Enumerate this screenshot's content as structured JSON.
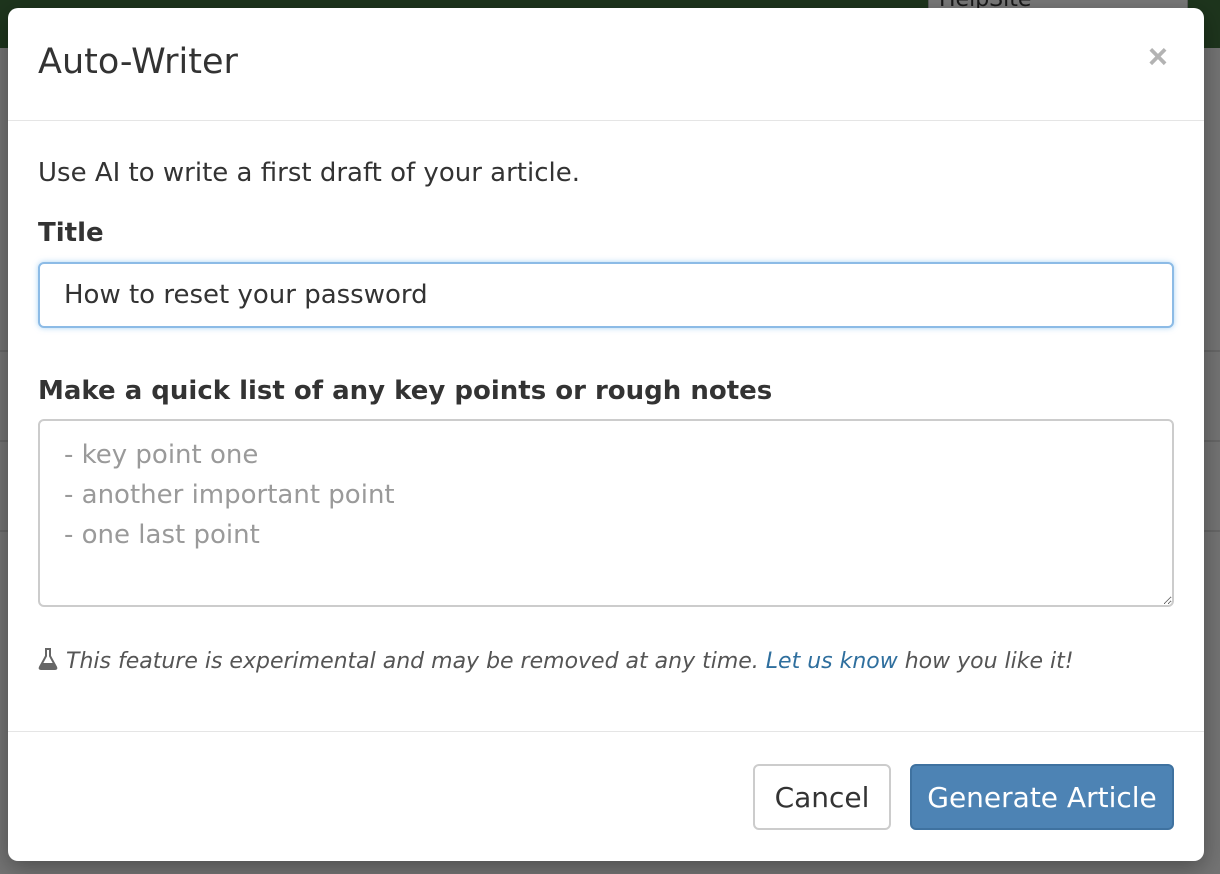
{
  "background": {
    "site_select_value": "HelpSite"
  },
  "modal": {
    "title": "Auto-Writer",
    "close_symbol": "×",
    "intro": "Use AI to write a first draft of your article.",
    "title_field": {
      "label": "Title",
      "value": "How to reset your password"
    },
    "notes_field": {
      "label": "Make a quick list of any key points or rough notes",
      "placeholder": "- key point one\n- another important point\n- one last point",
      "value": ""
    },
    "experimental_note": {
      "icon": "flask-icon",
      "text_before": "This feature is experimental and may be removed at any time.",
      "link_text": "Let us know",
      "text_after": "how you like it!"
    },
    "footer": {
      "cancel_label": "Cancel",
      "generate_label": "Generate Article"
    }
  },
  "colors": {
    "primary_button": "#4d83b4",
    "link": "#2f6f9e",
    "focus_border": "#8cbbe6"
  }
}
